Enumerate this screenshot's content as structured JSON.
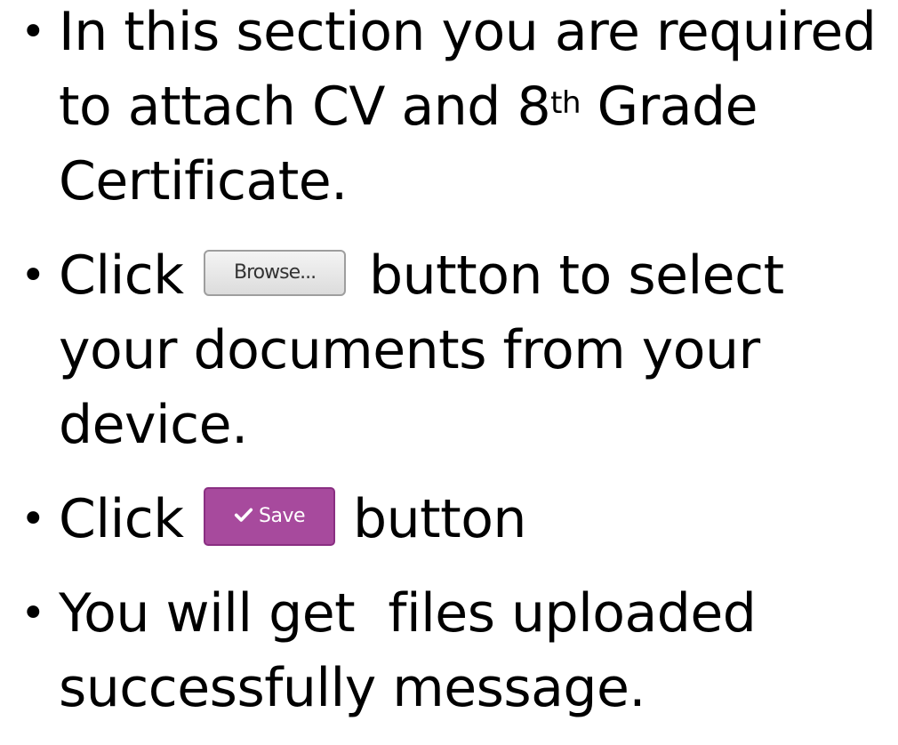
{
  "bullets": [
    {
      "text_before": "In this section you are required to attach CV and 8",
      "superscript": "th",
      "text_after": " Grade Certificate."
    },
    {
      "text_before": "Click",
      "text_after": "button to select your documents from your device."
    },
    {
      "text_before": "Click",
      "text_after": "button"
    },
    {
      "text": "You will get  files uploaded successfully message."
    }
  ],
  "bullet_symbol": "•",
  "browse_button": {
    "label": "Browse..."
  },
  "save_button": {
    "label": "Save",
    "icon": "check-icon",
    "color": "#a74a9d"
  }
}
